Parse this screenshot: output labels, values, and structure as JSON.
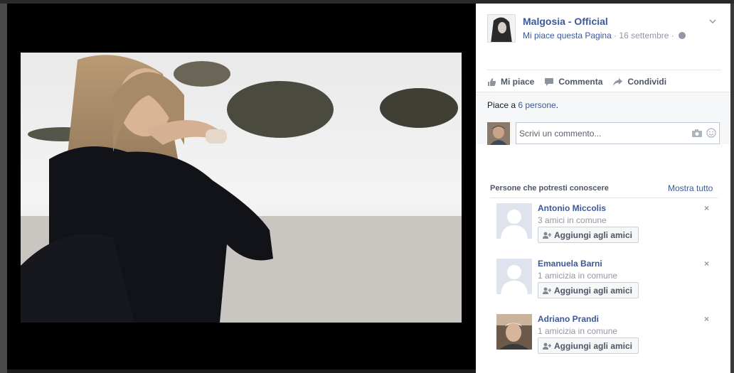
{
  "post": {
    "page_name": "Malgosia - Official",
    "like_page_label": "Mi piace questa Pagina",
    "separator": " · ",
    "date": "16 settembre",
    "separator2": " · "
  },
  "actions": {
    "like": "Mi piace",
    "comment": "Commenta",
    "share": "Condividi"
  },
  "likes": {
    "prefix": "Piace a ",
    "link": "6 persone",
    "suffix": "."
  },
  "comment": {
    "placeholder": "Scrivi un commento..."
  },
  "pymk": {
    "title": "Persone che potresti conoscere",
    "see_all": "Mostra tutto",
    "people": [
      {
        "name": "Antonio Miccolis",
        "mutual": "3 amici in comune",
        "button": "Aggiungi agli amici",
        "close": "×"
      },
      {
        "name": "Emanuela Barni",
        "mutual": "1 amicizia in comune",
        "button": "Aggiungi agli amici",
        "close": "×"
      },
      {
        "name": "Adriano Prandi",
        "mutual": "1 amicizia in comune",
        "button": "Aggiungi agli amici",
        "close": "×"
      }
    ]
  },
  "colors": {
    "link": "#3b5998",
    "meta": "#9197a3",
    "theater": "#000000"
  },
  "icons": [
    "thumbs-up-icon",
    "comment-icon",
    "share-icon",
    "camera-icon",
    "smiley-icon",
    "globe-icon",
    "chevron-down-icon",
    "add-friend-icon",
    "silhouette-icon"
  ]
}
